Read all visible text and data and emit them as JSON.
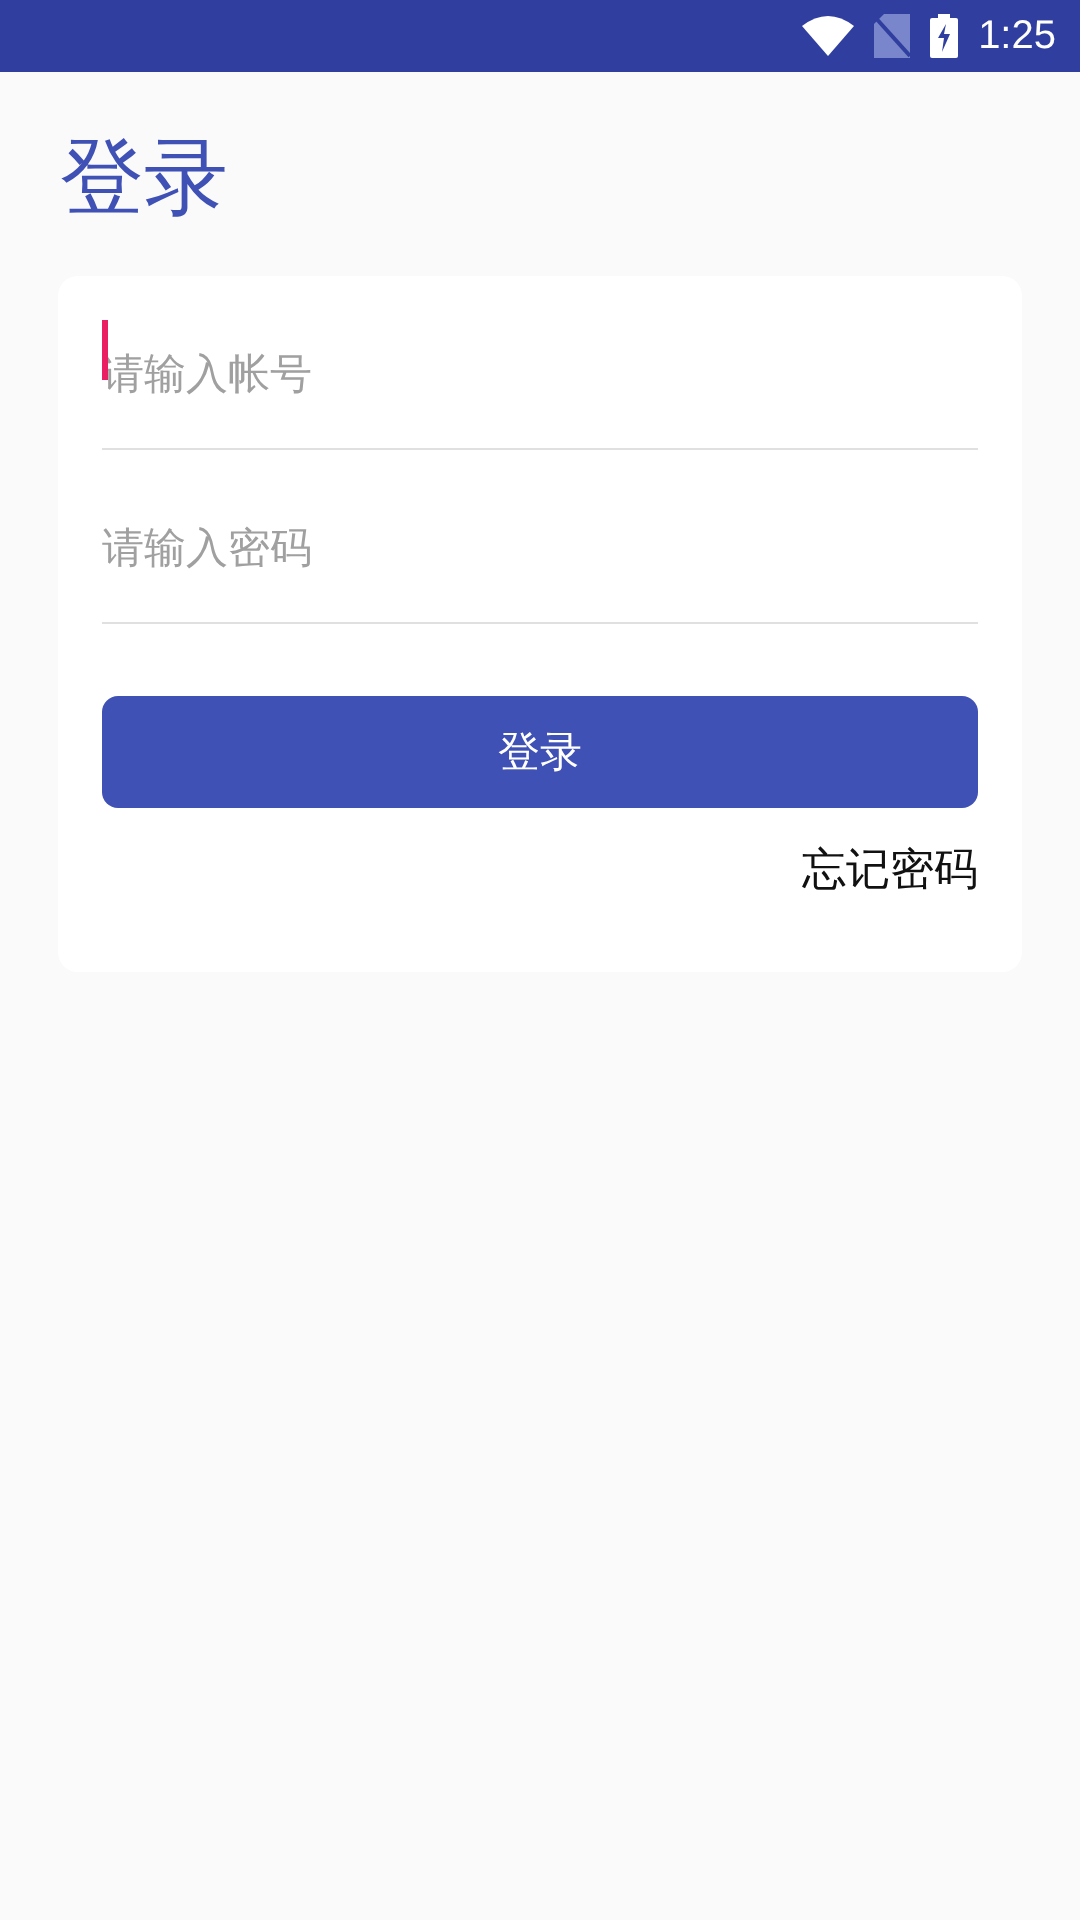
{
  "status_bar": {
    "time": "1:25"
  },
  "title": "登录",
  "fields": [
    {
      "placeholder": "请输入帐号",
      "focused": true
    },
    {
      "placeholder": "请输入密码",
      "focused": false
    }
  ],
  "login_button": "登录",
  "forgot_link": "忘记密码"
}
